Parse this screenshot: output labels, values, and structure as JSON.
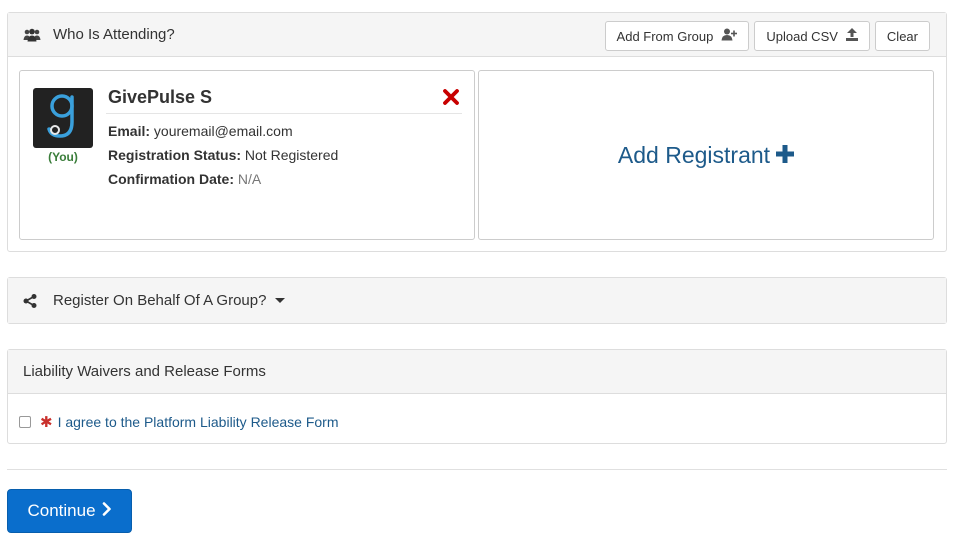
{
  "attending": {
    "title": "Who Is Attending?",
    "buttons": {
      "add_from_group": "Add From Group",
      "upload_csv": "Upload CSV",
      "clear": "Clear"
    },
    "registrant": {
      "name": "GivePulse S",
      "you_label": "(You)",
      "email_label": "Email:",
      "email_value": "youremail@email.com",
      "status_label": "Registration Status:",
      "status_value": "Not Registered",
      "confirm_label": "Confirmation Date:",
      "confirm_value": "N/A"
    },
    "add_registrant": "Add Registrant"
  },
  "group": {
    "title": "Register On Behalf Of A Group?"
  },
  "waivers": {
    "title": "Liability Waivers and Release Forms",
    "required_marker": "✱",
    "agree_text": "I agree to the Platform Liability Release Form",
    "checked": false
  },
  "continue_label": "Continue",
  "colors": {
    "primary": "#0a6ecc",
    "link": "#1d5a8a",
    "danger": "#c9302c",
    "you": "#3a7d3a"
  }
}
